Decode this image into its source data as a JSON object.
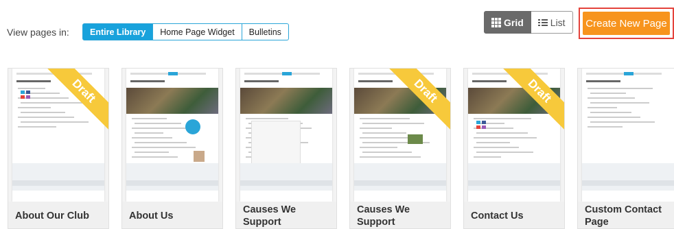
{
  "view_pages": {
    "label": "View pages in:",
    "options": [
      {
        "label": "Entire Library",
        "active": true
      },
      {
        "label": "Home Page Widget",
        "active": false
      },
      {
        "label": "Bulletins",
        "active": false
      }
    ]
  },
  "view_toggle": {
    "grid_label": "Grid",
    "list_label": "List",
    "selected": "Grid"
  },
  "create_button": {
    "label": "Create New Page",
    "color": "#f7941d",
    "highlight_color": "#e4423b"
  },
  "draft_label": "Draft",
  "pages": [
    {
      "title": "About Our Club",
      "draft": true
    },
    {
      "title": "About Us",
      "draft": false
    },
    {
      "title": "Causes We Support",
      "draft": false
    },
    {
      "title": "Causes We Support",
      "draft": true
    },
    {
      "title": "Contact Us",
      "draft": true
    },
    {
      "title": "Custom Contact Page",
      "draft": false
    }
  ],
  "colors": {
    "accent": "#18a2dc",
    "draft_ribbon": "#f7c93b"
  }
}
